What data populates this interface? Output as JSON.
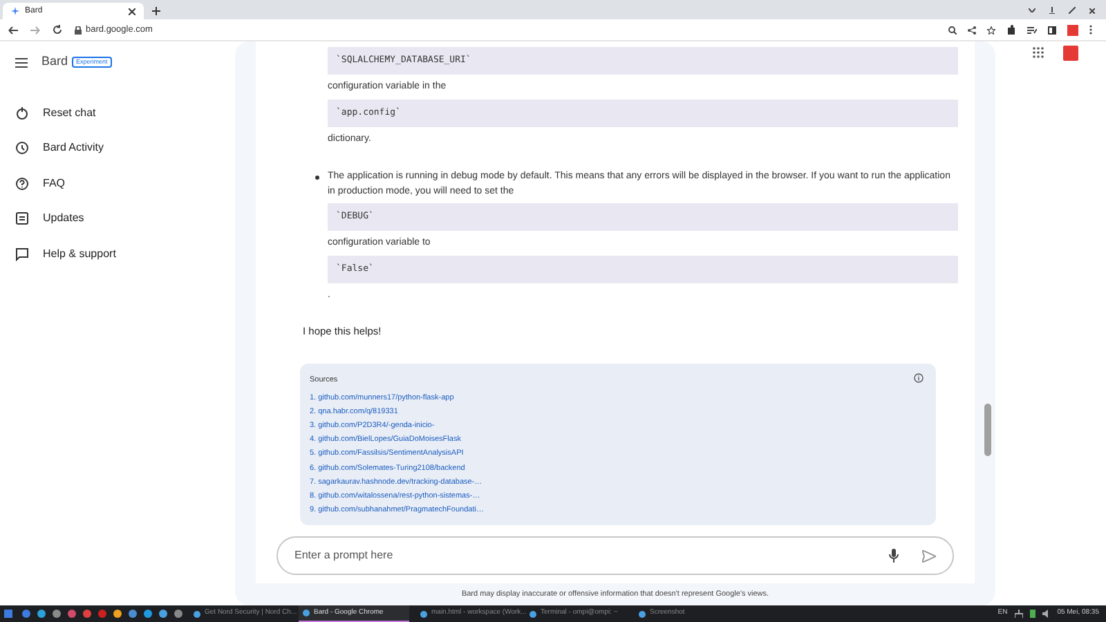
{
  "browser": {
    "tab_title": "Bard",
    "url": "bard.google.com"
  },
  "app": {
    "title": "Bard",
    "badge": "Experiment"
  },
  "sidebar": {
    "items": [
      {
        "label": "Reset chat"
      },
      {
        "label": "Bard Activity"
      },
      {
        "label": "FAQ"
      },
      {
        "label": "Updates"
      },
      {
        "label": "Help & support"
      }
    ]
  },
  "response": {
    "blocks": [
      {
        "kind": "code",
        "text": "`SQLALCHEMY_DATABASE_URI`"
      },
      {
        "kind": "text",
        "text": "configuration variable in the"
      },
      {
        "kind": "code",
        "text": "`app.config`"
      },
      {
        "kind": "text",
        "text": "dictionary."
      },
      {
        "kind": "bullet",
        "text": "The application is running in debug mode by default. This means that any errors will be displayed in the browser. If you want to run the application in production mode, you will need to set the"
      },
      {
        "kind": "code",
        "text": "`DEBUG`"
      },
      {
        "kind": "text",
        "text": "configuration variable to"
      },
      {
        "kind": "code",
        "text": "`False`"
      },
      {
        "kind": "text",
        "text": "."
      }
    ],
    "closing": "I hope this helps!"
  },
  "sources": {
    "title": "Sources",
    "items": [
      "1. github.com/munners17/python-flask-app",
      "2. qna.habr.com/q/819331",
      "3. github.com/P2D3R4/-genda-inicio-",
      "4. github.com/BielLopes/GuiaDoMoisesFlask",
      "5. github.com/Fassilsis/SentimentAnalysisAPI",
      "6. github.com/Solemates-Turing2108/backend",
      "7. sagarkaurav.hashnode.dev/tracking-database-…",
      "8. github.com/witalossena/rest-python-sistemas-…",
      "9. github.com/subhanahmet/PragmatechFoundati…"
    ]
  },
  "prompt": {
    "placeholder": "Enter a prompt here"
  },
  "disclaimer": "Bard may display inaccurate or offensive information that doesn't represent Google's views.",
  "taskbar": {
    "windows": [
      {
        "label": "Get Nord Security | Nord Ch...",
        "selected": false
      },
      {
        "label": "Bard - Google Chrome",
        "selected": true
      },
      {
        "label": "main.html - workspace (Work...",
        "selected": false
      },
      {
        "label": "Terminal - ompi@ompi: ~",
        "selected": false
      },
      {
        "label": "Screenshot",
        "selected": false
      }
    ],
    "language": "EN",
    "clock": "05 Mei, 08:35"
  }
}
